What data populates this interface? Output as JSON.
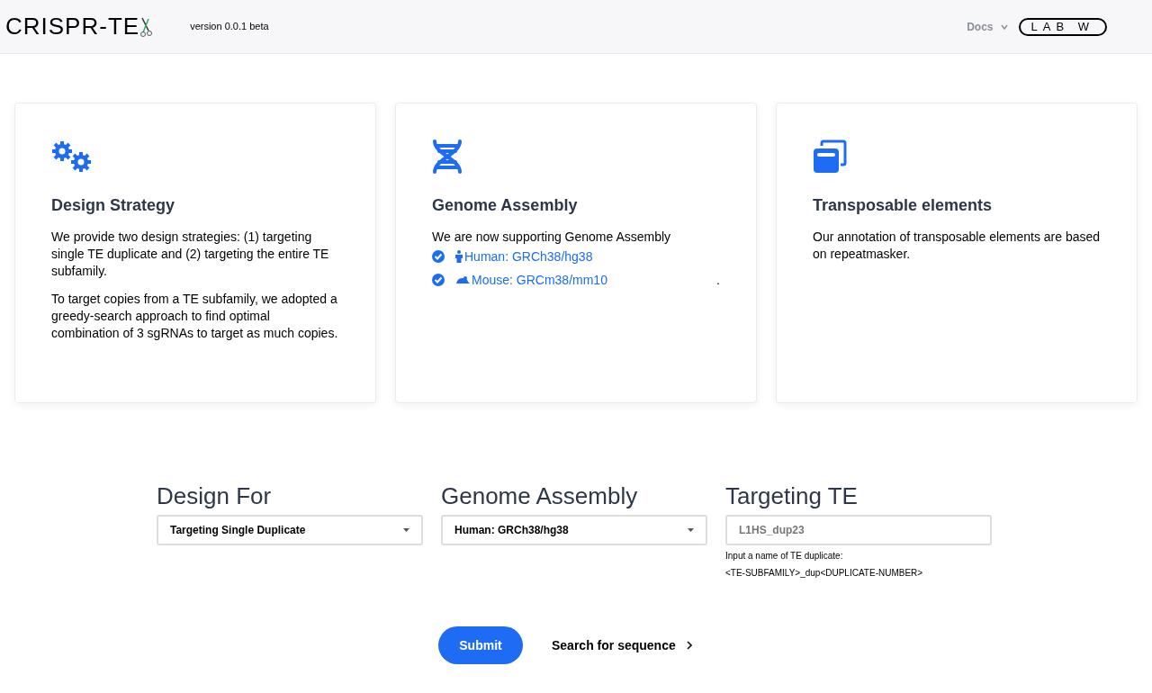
{
  "header": {
    "logo": "CRISPR-TE",
    "version": "version 0.0.1 beta",
    "nav": [
      {
        "label": "Docs",
        "expanded": false
      }
    ],
    "lab_logo": "LAB W"
  },
  "cards": [
    {
      "title": "Design Strategy",
      "paragraphs": [
        "We provide two design strategies: (1) targeting single TE duplicate and (2) targeting the entire TE subfamily.",
        "To target copies from a TE subfamily, we adopted a greedy-search approach to find optimal combination of 3 sgRNAs to target as much copies."
      ]
    },
    {
      "title": "Genome Assembly",
      "paragraphs": [
        "We are now supporting Genome Assembly"
      ],
      "assemblies": [
        {
          "label": "Human: GRCh38/hg38",
          "checked": true
        },
        {
          "label": "Mouse: GRCm38/mm10",
          "checked": true,
          "trailing": "."
        }
      ]
    },
    {
      "title": "Transposable elements",
      "paragraphs": [
        "Our annotation of transposable elements are based on repeatmasker."
      ]
    }
  ],
  "form": {
    "fields": [
      {
        "kind": "select",
        "heading": "Design For",
        "value": "Targeting Single Duplicate"
      },
      {
        "kind": "select",
        "heading": "Genome Assembly",
        "value": "Human: GRCh38/hg38"
      },
      {
        "kind": "text",
        "heading": "Targeting TE",
        "placeholder": "L1HS_dup23",
        "help": [
          "Input a name of TE duplicate:",
          "<TE-SUBFAMILY>_dup<DUPLICATE-NUMBER>"
        ]
      }
    ],
    "submit": "Submit",
    "link": "Search for sequence"
  }
}
